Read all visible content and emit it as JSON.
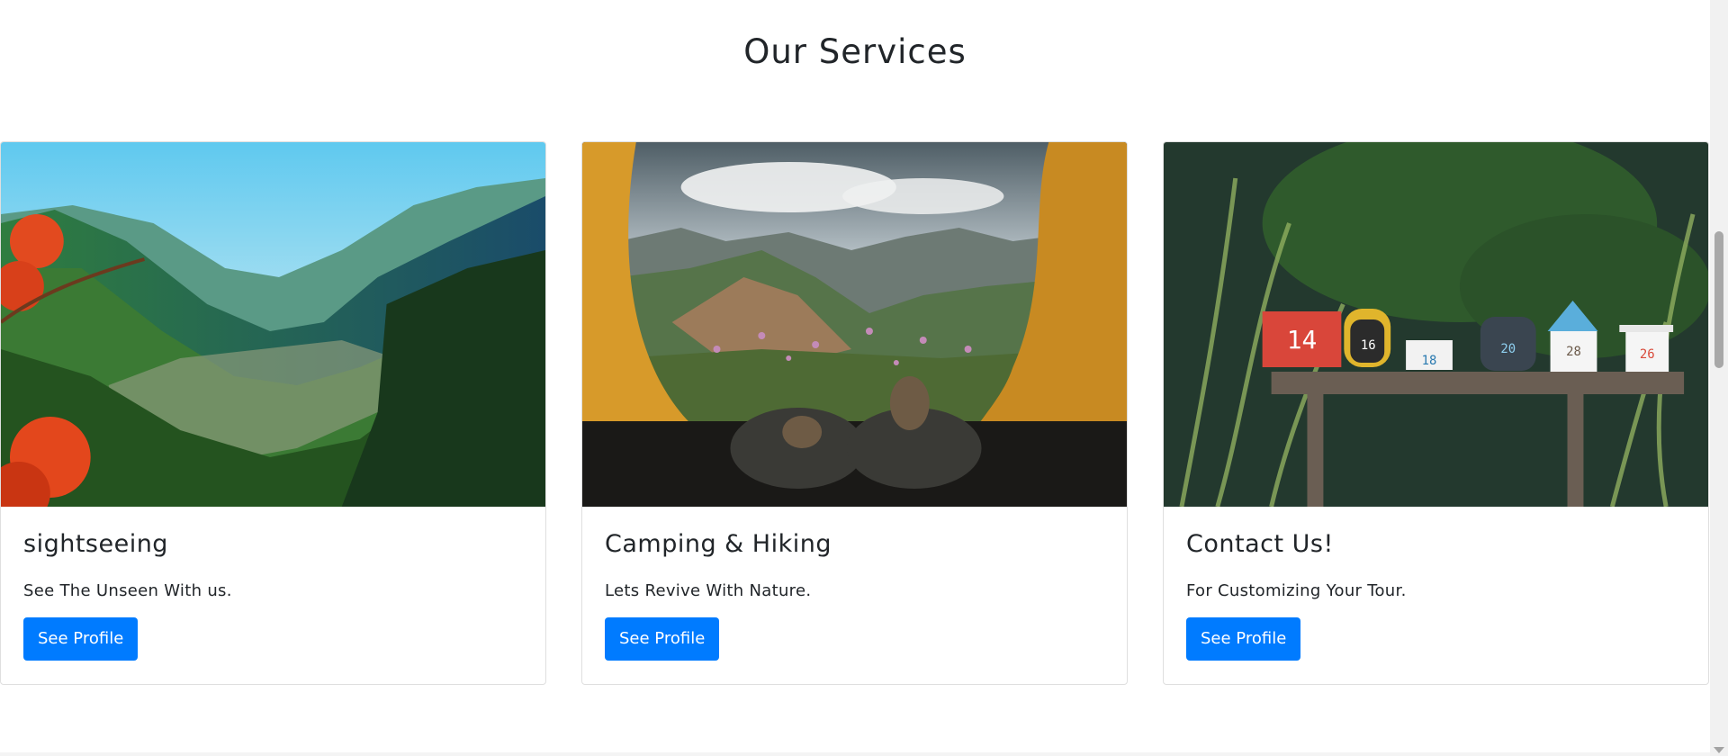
{
  "section": {
    "title": "Our Services"
  },
  "cards": [
    {
      "title": "sightseeing",
      "text": "See The Unseen With us.",
      "button": "See Profile",
      "image_icon": "mountain-valley-photo"
    },
    {
      "title": "Camping & Hiking",
      "text": "Lets Revive With Nature.",
      "button": "See Profile",
      "image_icon": "tent-view-photo"
    },
    {
      "title": "Contact Us!",
      "text": "For Customizing Your Tour.",
      "button": "See Profile",
      "image_icon": "mailboxes-photo"
    }
  ],
  "mailbox_numbers": [
    "14",
    "16",
    "18",
    "20",
    "28",
    "26"
  ],
  "colors": {
    "accent": "#007bff",
    "text": "#212529"
  }
}
